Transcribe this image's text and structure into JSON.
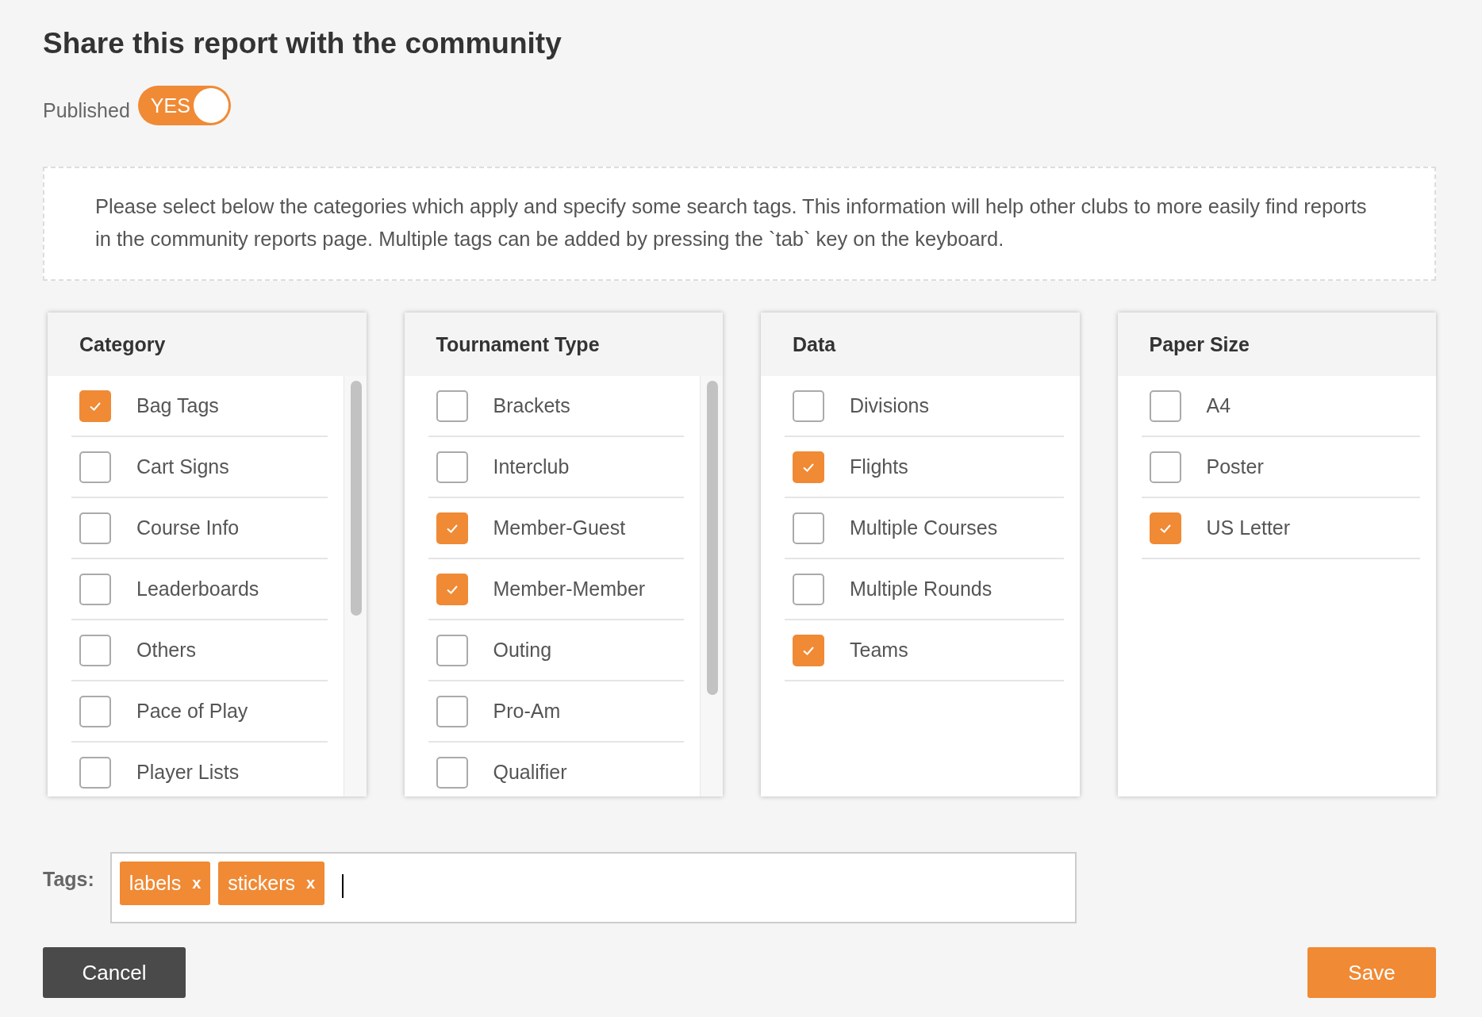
{
  "title": "Share this report with the community",
  "published": {
    "label": "Published",
    "on": true,
    "on_text": "YES"
  },
  "notice": "Please select below the categories which apply and specify some search tags. This information will help other clubs to more easily find reports in the community reports page. Multiple tags can be added by pressing the `tab` key on the keyboard.",
  "panels": [
    {
      "title": "Category",
      "scrollable": true,
      "items": [
        {
          "label": "Bag Tags",
          "checked": true
        },
        {
          "label": "Cart Signs",
          "checked": false
        },
        {
          "label": "Course Info",
          "checked": false
        },
        {
          "label": "Leaderboards",
          "checked": false
        },
        {
          "label": "Others",
          "checked": false
        },
        {
          "label": "Pace of Play",
          "checked": false
        },
        {
          "label": "Player Lists",
          "checked": false
        }
      ]
    },
    {
      "title": "Tournament Type",
      "scrollable": true,
      "items": [
        {
          "label": "Brackets",
          "checked": false
        },
        {
          "label": "Interclub",
          "checked": false
        },
        {
          "label": "Member-Guest",
          "checked": true
        },
        {
          "label": "Member-Member",
          "checked": true
        },
        {
          "label": "Outing",
          "checked": false
        },
        {
          "label": "Pro-Am",
          "checked": false
        },
        {
          "label": "Qualifier",
          "checked": false
        }
      ]
    },
    {
      "title": "Data",
      "scrollable": false,
      "items": [
        {
          "label": "Divisions",
          "checked": false
        },
        {
          "label": "Flights",
          "checked": true
        },
        {
          "label": "Multiple Courses",
          "checked": false
        },
        {
          "label": "Multiple Rounds",
          "checked": false
        },
        {
          "label": "Teams",
          "checked": true
        }
      ]
    },
    {
      "title": "Paper Size",
      "scrollable": false,
      "items": [
        {
          "label": "A4",
          "checked": false
        },
        {
          "label": "Poster",
          "checked": false
        },
        {
          "label": "US Letter",
          "checked": true
        }
      ]
    }
  ],
  "tags": {
    "label": "Tags:",
    "items": [
      {
        "text": "labels",
        "remove": "x"
      },
      {
        "text": "stickers",
        "remove": "x"
      }
    ]
  },
  "buttons": {
    "cancel": "Cancel",
    "save": "Save"
  }
}
